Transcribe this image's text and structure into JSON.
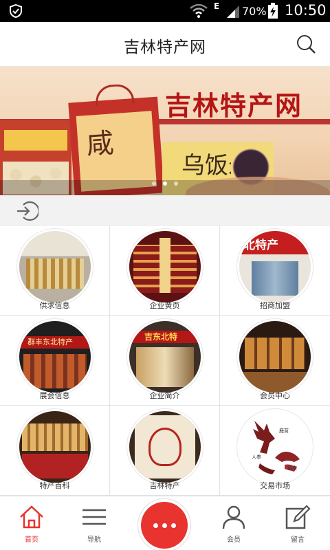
{
  "status_bar": {
    "network_type": "E",
    "battery_percent": "70%",
    "time": "10:50"
  },
  "header": {
    "title": "吉林特产网"
  },
  "banner": {
    "headline": "吉林特产网",
    "product_glyph_1": "咸",
    "product_glyph_2": "乌饭米",
    "slide_count": 3,
    "active_slide": 2
  },
  "grid": {
    "items": [
      {
        "label": "供求信息",
        "image": "showroom-shelves"
      },
      {
        "label": "企业黄页",
        "image": "store-interior-red"
      },
      {
        "label": "招商加盟",
        "image": "storefront-sign",
        "sign_text": "北特产"
      },
      {
        "label": "展会信息",
        "image": "shop-facade",
        "sign_text": "群丰东北特产"
      },
      {
        "label": "企业简介",
        "image": "shop-entrance",
        "sign_text": "吉东北特"
      },
      {
        "label": "会员中心",
        "image": "display-cabinets"
      },
      {
        "label": "特产百科",
        "image": "product-shelves"
      },
      {
        "label": "吉林特产",
        "image": "ginseng-display"
      },
      {
        "label": "交易市场",
        "image": "deer-ginseng-logo",
        "caption_1": "鹿茸",
        "caption_2": "人参",
        "caption_3": "貂皮"
      }
    ]
  },
  "bottom_nav": {
    "home": "首页",
    "navigation": "导航",
    "member": "会员",
    "message": "留言"
  },
  "colors": {
    "accent": "#e8332f",
    "banner_red": "#b51515",
    "status_bar": "#000000"
  }
}
